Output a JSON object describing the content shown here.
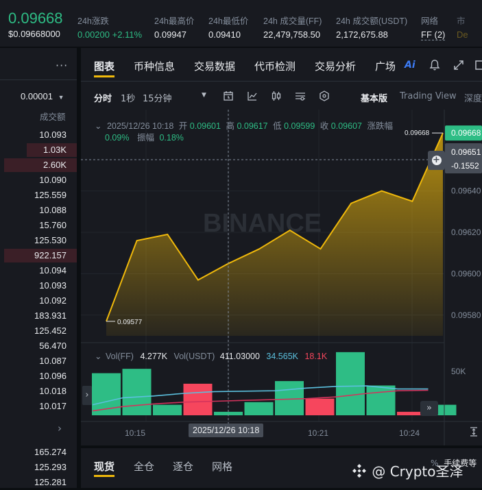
{
  "ticker": {
    "price": "0.09668",
    "price_usd": "$0.09668000",
    "stats": [
      {
        "label": "24h涨跌",
        "value": "0.00200 +2.11%",
        "color": "green"
      },
      {
        "label": "24h最高价",
        "value": "0.09947",
        "color": "white"
      },
      {
        "label": "24h最低价",
        "value": "0.09410",
        "color": "white"
      },
      {
        "label": "24h 成交量(FF)",
        "value": "22,479,758.50",
        "color": "white"
      },
      {
        "label": "24h 成交额(USDT)",
        "value": "2,172,675.88",
        "color": "white"
      },
      {
        "label": "网络",
        "value": "FF (2)",
        "color": "white"
      },
      {
        "label": "市",
        "value": "De",
        "color": "muted"
      }
    ]
  },
  "orderbook": {
    "menu_icon": "more-dots-icon",
    "precision": "0.00001",
    "column_header": "成交额",
    "rows": [
      {
        "value": "10.093",
        "bar": 0
      },
      {
        "value": "1.03K",
        "bar": 0.65
      },
      {
        "value": "2.60K",
        "bar": 0.95
      },
      {
        "value": "10.090",
        "bar": 0
      },
      {
        "value": "125.559",
        "bar": 0
      },
      {
        "value": "10.088",
        "bar": 0
      },
      {
        "value": "15.760",
        "bar": 0
      },
      {
        "value": "125.530",
        "bar": 0
      },
      {
        "value": "922.157",
        "bar": 0.95
      },
      {
        "value": "10.094",
        "bar": 0
      },
      {
        "value": "10.093",
        "bar": 0
      },
      {
        "value": "10.092",
        "bar": 0
      },
      {
        "value": "183.931",
        "bar": 0
      },
      {
        "value": "125.452",
        "bar": 0
      },
      {
        "value": "56.470",
        "bar": 0
      },
      {
        "value": "10.087",
        "bar": 0
      },
      {
        "value": "10.096",
        "bar": 0
      },
      {
        "value": "10.018",
        "bar": 0
      },
      {
        "value": "10.017",
        "bar": 0
      }
    ],
    "rows_bottom": [
      "165.274",
      "125.293",
      "125.281"
    ]
  },
  "tabs": [
    "图表",
    "币种信息",
    "交易数据",
    "代币检测",
    "交易分析",
    "广场"
  ],
  "toolbar": {
    "intervals": [
      "分时",
      "1秒",
      "15分钟"
    ],
    "version": "基本版",
    "tradingview": "Trading View",
    "depth": "深度"
  },
  "ohlc": {
    "date": "2025/12/26 10:18",
    "open_label": "开",
    "open": "0.09601",
    "high_label": "高",
    "high": "0.09617",
    "low_label": "低",
    "low": "0.09599",
    "close_label": "收",
    "close": "0.09607",
    "change_label": "涨跌幅",
    "change": "0.09%",
    "amp_label": "振幅",
    "amp": "0.18%"
  },
  "volume_legend": {
    "vol_ff_label": "Vol(FF)",
    "vol_ff": "4.277K",
    "vol_usdt_label": "Vol(USDT)",
    "vol_usdt": "411.03000",
    "ma1": "34.565K",
    "ma2": "18.1K"
  },
  "crosshair_time": "2025/12/26 10:18",
  "watermark_brand": "BINANCE",
  "chart_data": {
    "type": "area",
    "price_series": [
      0.09577,
      0.09616,
      0.09619,
      0.09597,
      0.09605,
      0.09612,
      0.09621,
      0.09612,
      0.09634,
      0.0964,
      0.09635,
      0.09668
    ],
    "price_labels": {
      "max": "0.09668",
      "min": "0.09577",
      "last": "0.09668",
      "crosshair": "0.09651",
      "crosshair_change": "-0.1552"
    },
    "y_ticks": [
      "0.09640",
      "0.09620",
      "0.09600",
      "0.09580"
    ],
    "y_range": [
      0.0957,
      0.09672
    ],
    "x_ticks": [
      "10:15",
      "10:21",
      "10:24"
    ],
    "volume": {
      "y_tick": "50K",
      "bars": [
        {
          "value": 48000,
          "dir": "up"
        },
        {
          "value": 53000,
          "dir": "up"
        },
        {
          "value": 12000,
          "dir": "up"
        },
        {
          "value": 36000,
          "dir": "down"
        },
        {
          "value": 4000,
          "dir": "up"
        },
        {
          "value": 15000,
          "dir": "up"
        },
        {
          "value": 39000,
          "dir": "up"
        },
        {
          "value": 19000,
          "dir": "down"
        },
        {
          "value": 72000,
          "dir": "up"
        },
        {
          "value": 34000,
          "dir": "up"
        },
        {
          "value": 4000,
          "dir": "down"
        },
        {
          "value": 12000,
          "dir": "up"
        }
      ],
      "ma_series_1": [
        12000,
        20000,
        22000,
        25000,
        27000,
        27500,
        28000,
        31000,
        33000,
        33500,
        30000,
        30000
      ],
      "ma_series_2": [
        5000,
        10000,
        13000,
        15000,
        16000,
        17000,
        18000,
        19000,
        21000,
        25000,
        28000,
        28500
      ],
      "y_range": [
        0,
        75000
      ]
    }
  },
  "bottom_tabs": [
    "现货",
    "全仓",
    "逐仓",
    "网格"
  ],
  "bottom_right": "手续费等",
  "watermark": "@ Crypto圣泽",
  "colors": {
    "up": "#2ebd85",
    "down": "#f6465d",
    "accent": "#f0b90b",
    "ma1": "#5bc0de",
    "ma2": "#d2335c"
  }
}
